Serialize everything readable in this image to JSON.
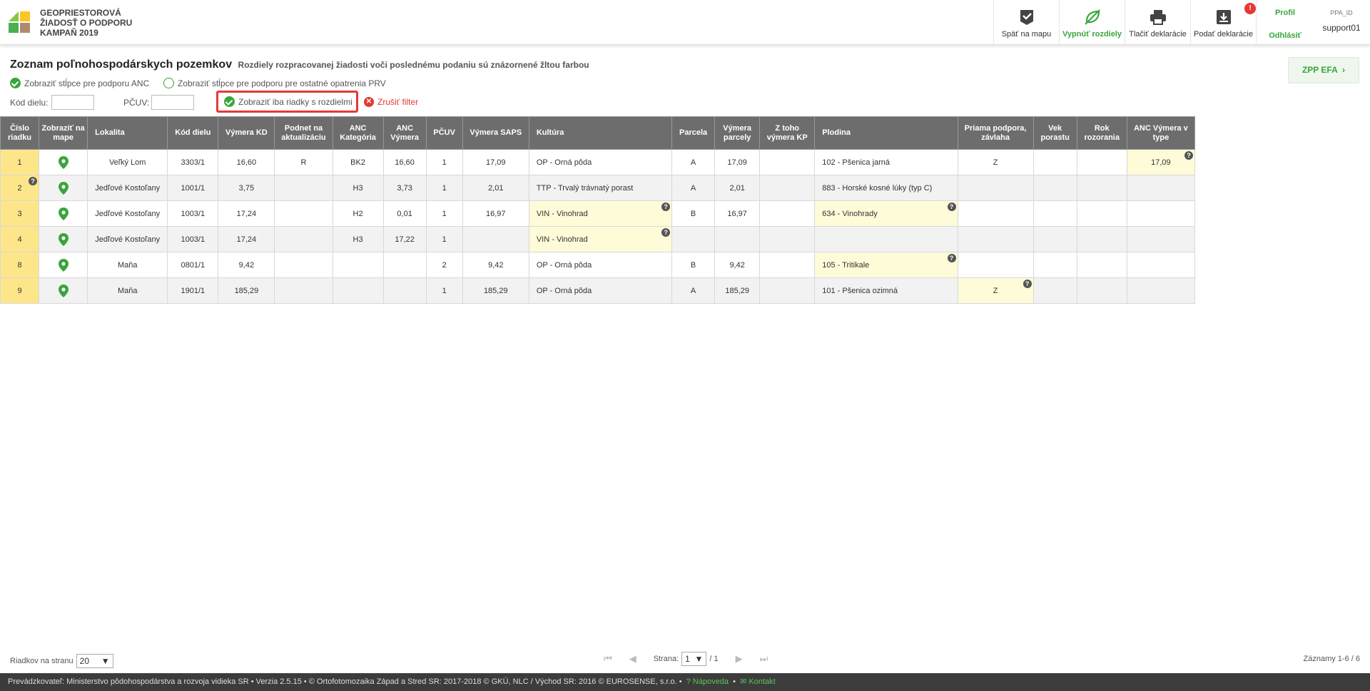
{
  "header": {
    "title_lines": [
      "GEOPRIESTOROVÁ",
      "ŽIADOSŤ O PODPORU",
      "KAMPAŇ 2019"
    ],
    "buttons": [
      {
        "label": "Späť na mapu",
        "icon": "map-check-icon"
      },
      {
        "label": "Vypnúť rozdiely",
        "icon": "eye-off-leaf-icon"
      },
      {
        "label": "Tlačiť deklarácie",
        "icon": "printer-icon"
      },
      {
        "label": "Podať deklarácie",
        "icon": "download-box-icon",
        "badge": "!"
      }
    ],
    "profile_label": "Profil",
    "logout_label": "Odhlásiť",
    "user_id_label": "PPA_ID",
    "user_name": "support01"
  },
  "page": {
    "title": "Zoznam poľnohospodárskych pozemkov",
    "subtitle": "Rozdiely rozpracovanej žiadosti voči poslednému podaniu sú znázornené žltou farbou",
    "zpp_button": "ZPP EFA",
    "option_anc": "Zobraziť stĺpce pre podporu ANC",
    "option_prv": "Zobraziť stĺpce pre podporu pre ostatné opatrenia PRV",
    "filter_kod_label": "Kód dielu:",
    "filter_pcuv_label": "PČUV:",
    "only_diff_label": "Zobraziť iba riadky s rozdielmi",
    "cancel_filter_label": "Zrušiť filter"
  },
  "table": {
    "headers": [
      "Číslo riadku",
      "Zobraziť na mape",
      "Lokalita",
      "Kód dielu",
      "Výmera KD",
      "Podnet na aktualizáciu",
      "ANC Kategória",
      "ANC Výmera",
      "PČUV",
      "Výmera SAPS",
      "Kultúra",
      "Parcela",
      "Výmera parcely",
      "Z toho výmera KP",
      "Plodina",
      "Priama podpora, závlaha",
      "Vek porastu",
      "Rok rozorania",
      "ANC Výmera v type"
    ],
    "rows": [
      [
        "1",
        "",
        "Veľký Lom",
        "3303/1",
        "16,60",
        "R",
        "BK2",
        "16,60",
        "1",
        "17,09",
        "OP - Orná pôda",
        "A",
        "17,09",
        "",
        "102 - Pšenica jarná",
        "Z",
        "",
        "",
        "17,09"
      ],
      [
        "2",
        "",
        "Jedľové Kostoľany",
        "1001/1",
        "3,75",
        "",
        "H3",
        "3,73",
        "1",
        "2,01",
        "TTP - Trvalý trávnatý porast",
        "A",
        "2,01",
        "",
        "883 - Horské kosné lúky (typ C)",
        "",
        "",
        "",
        ""
      ],
      [
        "3",
        "",
        "Jedľové Kostoľany",
        "1003/1",
        "17,24",
        "",
        "H2",
        "0,01",
        "1",
        "16,97",
        "VIN - Vinohrad",
        "B",
        "16,97",
        "",
        "634 - Vinohrady",
        "",
        "",
        "",
        ""
      ],
      [
        "4",
        "",
        "Jedľové Kostoľany",
        "1003/1",
        "17,24",
        "",
        "H3",
        "17,22",
        "1",
        "",
        "VIN - Vinohrad",
        "",
        "",
        "",
        "",
        "",
        "",
        "",
        ""
      ],
      [
        "8",
        "",
        "Maňa",
        "0801/1",
        "9,42",
        "",
        "",
        "",
        "2",
        "9,42",
        "OP - Orná pôda",
        "B",
        "9,42",
        "",
        "105 - Tritikale",
        "",
        "",
        "",
        ""
      ],
      [
        "9",
        "",
        "Maňa",
        "1901/1",
        "185,29",
        "",
        "",
        "",
        "1",
        "185,29",
        "OP - Orná pôda",
        "A",
        "185,29",
        "",
        "101 - Pšenica ozimná",
        "Z",
        "",
        "",
        ""
      ]
    ]
  },
  "pager": {
    "rows_per_page_label": "Riadkov na stranu",
    "rows_per_page_value": "20",
    "page_label": "Strana:",
    "page_value": "1",
    "page_total": "/ 1",
    "records": "Záznamy 1-6 / 6"
  },
  "footer": {
    "text": "Prevádzkovateľ: Ministerstvo pôdohospodárstva a rozvoja vidieka SR • Verzia 2.5.15 • © Ortofotomozaika Západ a Stred SR: 2017-2018 © GKÚ, NLC / Východ SR: 2016 © EUROSENSE, s.r.o. •",
    "help_label": "Nápoveda",
    "contact_label": "Kontakt"
  },
  "colors": {
    "accent_green": "#3aa53a",
    "diff_yellow": "#fefbd8",
    "row_number_yellow": "#fde68a",
    "alert_red": "#e53935",
    "header_gray": "#6d6d6d"
  }
}
